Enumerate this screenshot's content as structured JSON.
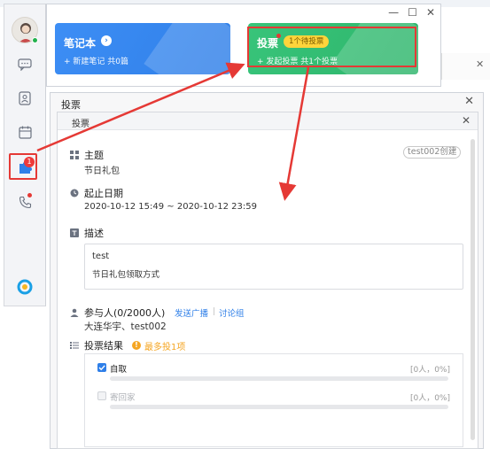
{
  "window": {
    "minimize_glyph": "—",
    "maximize_glyph": "☐",
    "close_glyph": "✕"
  },
  "sidebar": {
    "avatar_icon": "user-avatar",
    "items": [
      {
        "icon": "chat-icon"
      },
      {
        "icon": "contacts-icon"
      },
      {
        "icon": "calendar-icon"
      },
      {
        "icon": "apps-icon",
        "badge": "1"
      },
      {
        "icon": "phone-icon"
      }
    ],
    "logo_icon": "app-logo"
  },
  "cards": {
    "notebook": {
      "title": "笔记本",
      "sub": "+ 新建笔记   共0篇",
      "arrow": "›"
    },
    "vote": {
      "title": "投票",
      "pending": "1个待投票",
      "sub": "+ 发起投票    共1个投票"
    }
  },
  "modal_outer": {
    "title": "投票",
    "close": "✕"
  },
  "modal": {
    "header": "投票",
    "close": "✕",
    "topic_label": "主题",
    "topic_value": "节日礼包",
    "creator": "test002创建",
    "date_label": "起止日期",
    "date_value": "2020-10-12 15:49 ~ 2020-10-12 23:59",
    "desc_label": "描述",
    "desc_line1": "test",
    "desc_line2": "节日礼包领取方式",
    "participants_label": "参与人(0/2000人)",
    "broadcast_link": "发送广播",
    "discussion_link": "讨论组",
    "participants_value": "大连华宇、test002",
    "results_label": "投票结果",
    "results_hint": "最多投1项",
    "options": [
      {
        "label": "自取",
        "count": "[0人，0%]",
        "checked": true,
        "fraction": 0
      },
      {
        "label": "寄回家",
        "count": "[0人，0%]",
        "checked": false,
        "fraction": 0
      }
    ]
  },
  "colors": {
    "accent_blue": "#2f7fe8",
    "accent_green": "#2eb56b",
    "highlight_red": "#e53935",
    "warning_orange": "#f5a623"
  }
}
